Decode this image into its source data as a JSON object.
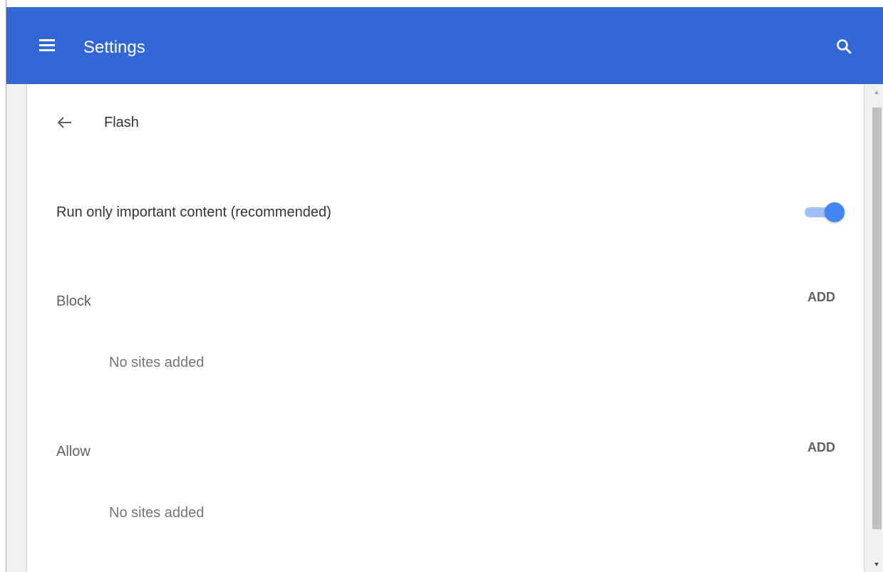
{
  "toolbar": {
    "title": "Settings",
    "menu_icon": "hamburger-menu-icon",
    "search_icon": "search-icon",
    "background_color": "#3367d6"
  },
  "page": {
    "back_icon": "arrow-back-icon",
    "title": "Flash"
  },
  "setting": {
    "label": "Run only important content (recommended)",
    "enabled": true,
    "accent_color": "#4285f4"
  },
  "sections": {
    "block": {
      "label": "Block",
      "add_label": "ADD",
      "empty_text": "No sites added"
    },
    "allow": {
      "label": "Allow",
      "add_label": "ADD",
      "empty_text": "No sites added"
    }
  }
}
